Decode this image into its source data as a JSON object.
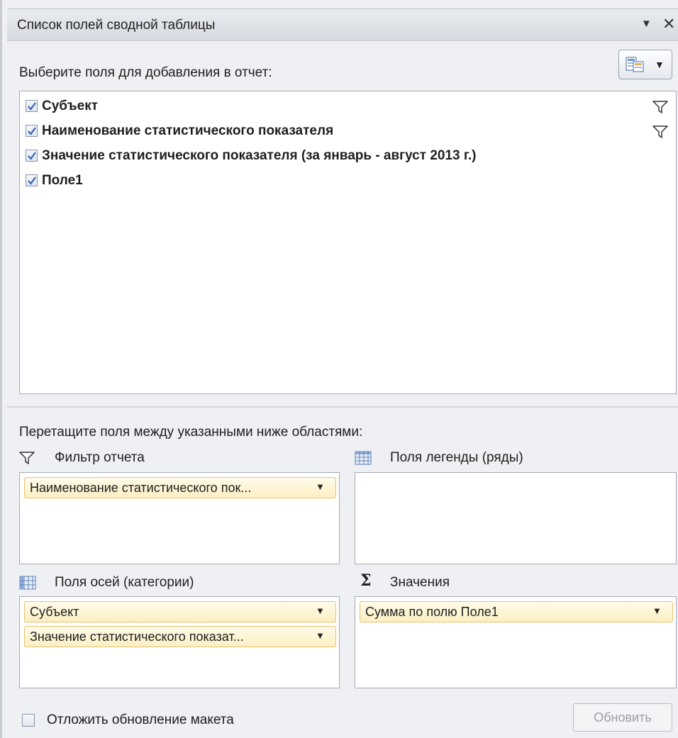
{
  "panel": {
    "title": "Список полей сводной таблицы",
    "instruction": "Выберите поля для добавления в отчет:"
  },
  "fields": [
    {
      "label": "Субъект",
      "checked": true,
      "filtered": true
    },
    {
      "label": "Наименование статистического показателя",
      "checked": true,
      "filtered": true
    },
    {
      "label": "Значение статистического показателя (за январь - август 2013 г.)",
      "checked": true,
      "filtered": false
    },
    {
      "label": "Поле1",
      "checked": true,
      "filtered": false
    }
  ],
  "areas": {
    "drag_instruction": "Перетащите поля между указанными ниже областями:",
    "report_filter": {
      "label": "Фильтр отчета",
      "items": [
        "Наименование статистического пок..."
      ]
    },
    "legend_fields": {
      "label": "Поля легенды (ряды)",
      "items": []
    },
    "axis_fields": {
      "label": "Поля осей (категории)",
      "items": [
        "Субъект",
        "Значение статистического показат..."
      ]
    },
    "values": {
      "label": "Значения",
      "items": [
        "Сумма по полю Поле1"
      ]
    }
  },
  "footer": {
    "defer_label": "Отложить обновление макета",
    "defer_checked": false,
    "update_label": "Обновить"
  },
  "icons": {
    "title_menu": "dropdown-triangle-icon",
    "title_close": "close-icon",
    "layout": "field-list-layout-icon",
    "filter": "funnel-icon",
    "legend": "grid-table-icon",
    "axis": "grid-table-icon",
    "values": "sigma-icon"
  },
  "colors": {
    "pill_border": "#e8c16f",
    "pill_fill": "#fcefc2",
    "check": "#3a64b4"
  }
}
